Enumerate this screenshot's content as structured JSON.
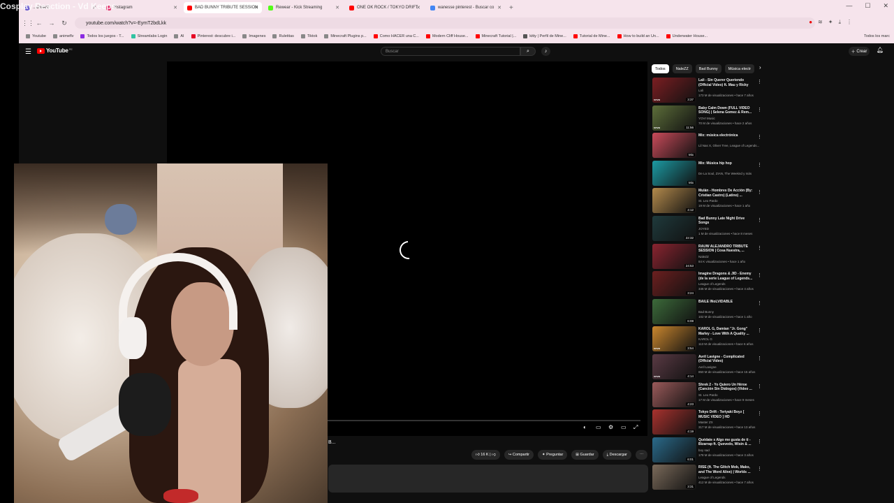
{
  "overlay": {
    "stream_title": "Cosplay Reaction - Vd Keeps"
  },
  "browser": {
    "tabs": [
      {
        "label": "...dboard",
        "color": "#6a5acd",
        "active": false
      },
      {
        "label": "Instagram",
        "color": "#e1306c",
        "active": false
      },
      {
        "label": "BAD BUNNY TRIBUTE SESSION",
        "color": "#ff0000",
        "active": true
      },
      {
        "label": "Rewear - Kick Streaming",
        "color": "#53fc18",
        "active": false
      },
      {
        "label": "ONE OK ROCK / TOKYO DRIFT",
        "color": "#ff0000",
        "active": false
      },
      {
        "label": "wanesse pinterest - Buscar co",
        "color": "#4285f4",
        "active": false
      }
    ],
    "url": "youtube.com/watch?v=-EymT2bdLkk",
    "bookmarks": [
      {
        "label": "Youtube",
        "color": "#888"
      },
      {
        "label": "animeflv",
        "color": "#888"
      },
      {
        "label": "Todos los juegos - T...",
        "color": "#8a2be2"
      },
      {
        "label": "Streamlabs Login",
        "color": "#31c3a2"
      },
      {
        "label": "AI",
        "color": "#888"
      },
      {
        "label": "Pinterest: descubre i...",
        "color": "#e60023"
      },
      {
        "label": "Imagenes",
        "color": "#888"
      },
      {
        "label": "Ruletitas",
        "color": "#888"
      },
      {
        "label": "Tiktok",
        "color": "#888"
      },
      {
        "label": "Minecraft Plugins p...",
        "color": "#888"
      },
      {
        "label": "Como HACER una C...",
        "color": "#ff0000"
      },
      {
        "label": "Modern Cliff House...",
        "color": "#ff0000"
      },
      {
        "label": "Minecraft Tutorial |...",
        "color": "#ff0000"
      },
      {
        "label": "kitty | Perfil de Mine...",
        "color": "#555"
      },
      {
        "label": "Tutorial de Mine...",
        "color": "#ff0000"
      },
      {
        "label": "How to build an Un...",
        "color": "#ff0000"
      },
      {
        "label": "Underwater House...",
        "color": "#ff0000"
      }
    ],
    "bookmarks_more": "Todos los marc"
  },
  "youtube": {
    "logo": "YouTube",
    "logo_cc": "PE",
    "search_placeholder": "Buscar",
    "create_label": "Crear",
    "video_title": "B...",
    "actions": {
      "likes": "16 K",
      "share": "Compartir",
      "ask": "Preguntar",
      "save": "Guardar",
      "download": "Descargar"
    },
    "chips": [
      "Todos",
      "NaleZZ",
      "Bad Bunny",
      "Música electr"
    ],
    "recommendations": [
      {
        "title": "Lali - Sin Querer Queriendo (Official Video) ft. Mau y Ricky",
        "channel": "Lali",
        "meta": "173 M de visualizaciones • hace 7 años",
        "duration": "3:37",
        "color": "#7b1e22",
        "vevo": true
      },
      {
        "title": "Baby Calm Down (FULL VIDEO SONG) | Selena Gomez & Rem...",
        "channel": "YOVI Music",
        "meta": "70 M de visualizaciones • hace 2 años",
        "duration": "11:56",
        "color": "#5d6e3a",
        "vevo": true
      },
      {
        "title": "Mix: música electrónica",
        "channel": "Lil Nas X, Oliver Tree, League of Legends...",
        "meta": "",
        "duration": "Mix",
        "color": "#c94b5a",
        "vevo": false
      },
      {
        "title": "Mix: Música hip hop",
        "channel": "De La Soul, ZIAN, The Weeknd y más",
        "meta": "",
        "duration": "Mix",
        "color": "#1c9aa3",
        "vevo": false
      },
      {
        "title": "Mulán - Hombres De Acción (By: Cristian Castro) (Latino) ...",
        "channel": "St. Leo Pardo",
        "meta": "19 M de visualizaciones • hace 1 año",
        "duration": "4:12",
        "color": "#b38a4c",
        "vevo": false
      },
      {
        "title": "Bad Bunny Late Night Drive Songs",
        "channel": "JOYED",
        "meta": "1 M de visualizaciones • hace 8 meses",
        "duration": "22:32",
        "color": "#1f3a3c",
        "vevo": false
      },
      {
        "title": "RAUW ALEJANDRO TRIBUTE SESSION | Cosa Nuestra, ...",
        "channel": "NaleZZ",
        "meta": "84 K visualizaciones • hace 1 año",
        "duration": "24:53",
        "color": "#8a2430",
        "vevo": false
      },
      {
        "title": "Imagine Dragons & JID - Enemy (de la serie League of Legends...",
        "channel": "League of Legends",
        "meta": "346 M de visualizaciones • hace 4 años",
        "duration": "3:24",
        "color": "#6b1f1f",
        "vevo": false
      },
      {
        "title": "BAILE INoLVIDABLE",
        "channel": "Bad Bunny",
        "meta": "102 M de visualizaciones • hace 1 año",
        "duration": "6:08",
        "color": "#3c6a3a",
        "vevo": false
      },
      {
        "title": "KAROL G, Damian \"Jr. Gong\" Marley - Love With A Quality ...",
        "channel": "KAROL G",
        "meta": "113 M de visualizaciones • hace 6 años",
        "duration": "3:54",
        "color": "#c9862e",
        "vevo": true
      },
      {
        "title": "Avril Lavigne - Complicated (Official Video)",
        "channel": "Avril Lavigne",
        "meta": "850 M de visualizaciones • hace 15 años",
        "duration": "4:14",
        "color": "#5a3a44",
        "vevo": true
      },
      {
        "title": "Shrek 2 - Yo Quiero Un Héroe (Canción Sin Diálogos) (Video ...",
        "channel": "St. Leo Pardo",
        "meta": "17 M de visualizaciones • hace 9 meses",
        "duration": "4:23",
        "color": "#9a5a5a",
        "vevo": false
      },
      {
        "title": "Tokyo Drift - Teriyaki Boyz [ MUSIC VIDEO ] HD",
        "channel": "Master ZX",
        "meta": "317 M de visualizaciones • hace 13 años",
        "duration": "4:19",
        "color": "#a8322e",
        "vevo": false
      },
      {
        "title": "Quédate x Algo me gusta de ti - Bizarrap ft. Quevedo, Wisin & ...",
        "channel": "boy sad",
        "meta": "178 M de visualizaciones • hace 3 años",
        "duration": "6:01",
        "color": "#2a6a8a",
        "vevo": false
      },
      {
        "title": "RISE (ft. The Glitch Mob, Mako, and The Word Alive) | Worlds ...",
        "channel": "League of Legends",
        "meta": "412 M de visualizaciones • hace 7 años",
        "duration": "3:31",
        "color": "#7a6a5a",
        "vevo": false
      }
    ]
  }
}
